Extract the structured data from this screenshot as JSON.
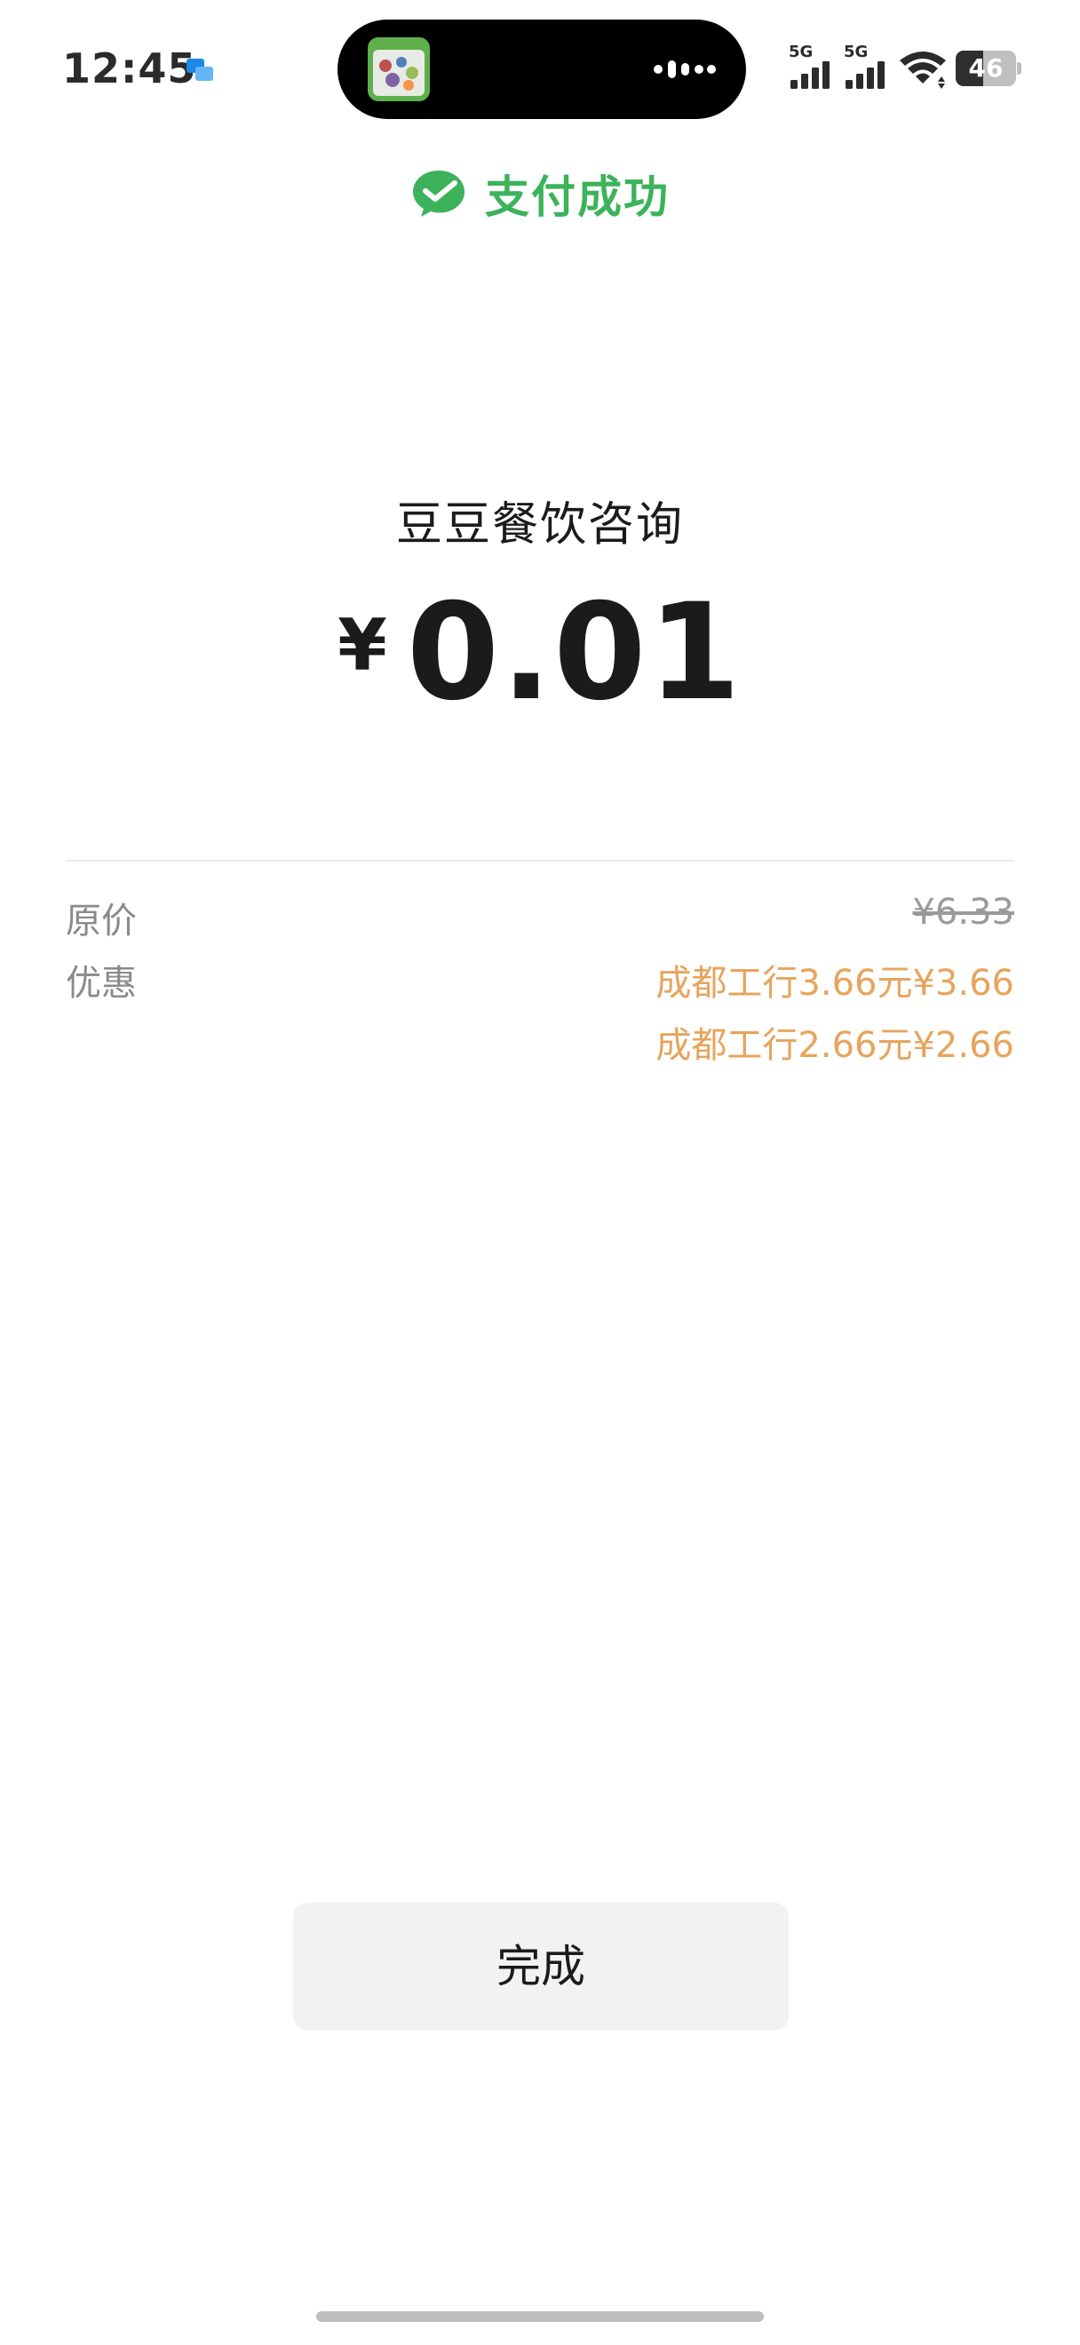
{
  "status_bar": {
    "time": "12:45",
    "notification_icon": "messages-app-icon",
    "network_1": "5G",
    "network_2": "5G",
    "wifi_icon": "wifi-icon",
    "battery_level": "46",
    "battery_fraction": 0.46
  },
  "dynamic_island": {
    "thumbnail_icon": "app-thumbnail-icon",
    "activity_icon": "audio-wave-icon"
  },
  "header": {
    "status_icon": "wechat-pay-success-icon",
    "status_text": "支付成功",
    "status_color": "#3cb35a"
  },
  "payment": {
    "merchant": "豆豆餐饮咨询",
    "currency_symbol": "¥",
    "amount": "0.01"
  },
  "details": {
    "original_price_label": "原价",
    "original_price_value": "¥6.33",
    "discount_label": "优惠",
    "discounts": [
      "成都工行3.66元¥3.66",
      "成都工行2.66元¥2.66"
    ],
    "discount_color": "#e7a45d"
  },
  "actions": {
    "done_label": "完成"
  }
}
